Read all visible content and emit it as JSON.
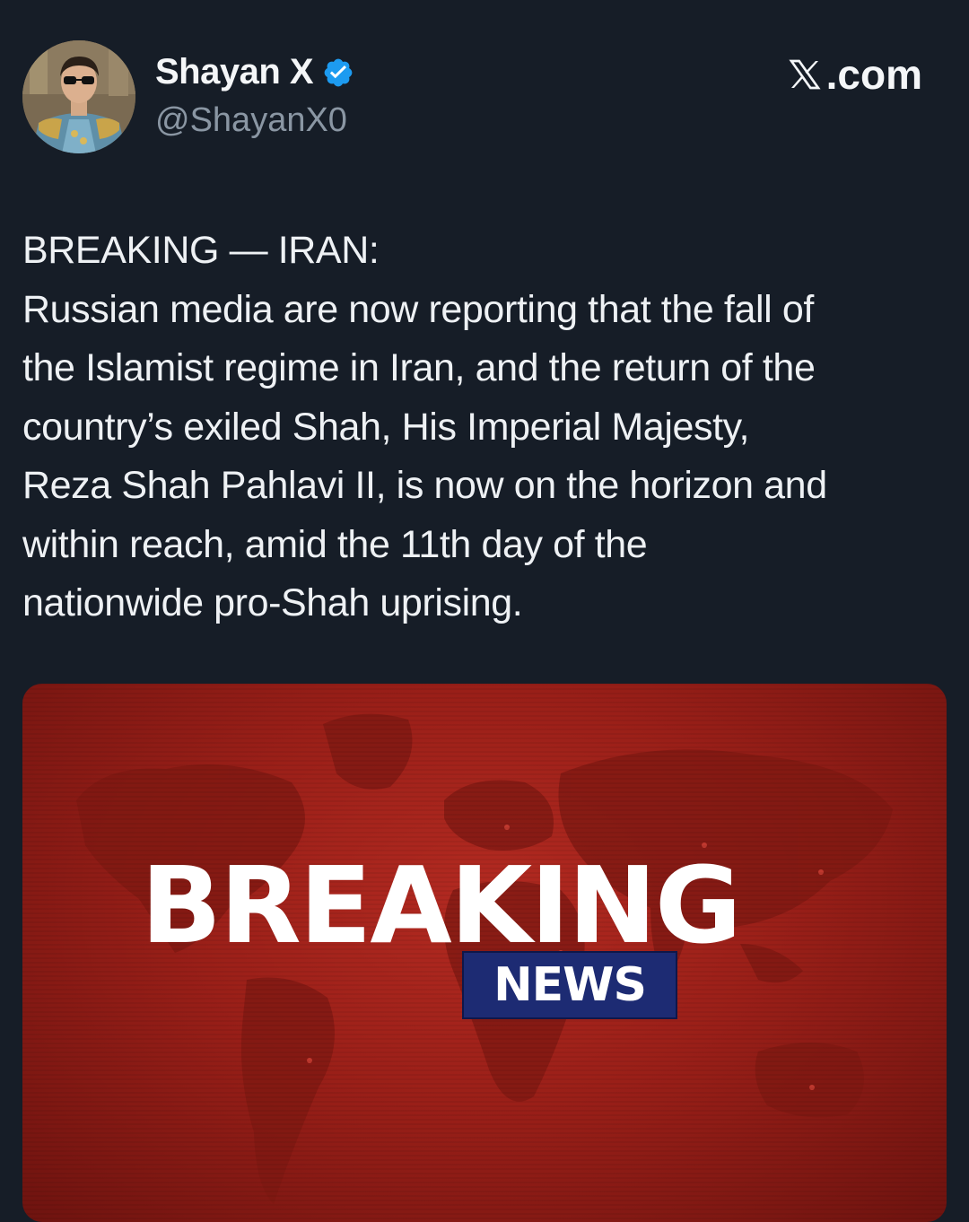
{
  "author": {
    "display_name": "Shayan X",
    "handle": "@ShayanX0",
    "verified_icon": "verified-badge-icon",
    "avatar_icon": "avatar-portrait-icon"
  },
  "site": {
    "label": ".com",
    "logo_icon": "x-logo-icon"
  },
  "tweet": {
    "lines": [
      "BREAKING — IRAN:",
      "Russian media are now reporting that the fall of",
      "the Islamist regime in Iran, and the return of the",
      "country’s exiled Shah, His Imperial Majesty,",
      "Reza Shah Pahlavi II, is now on the horizon and",
      "within reach, amid the 11th day of the",
      "nationwide pro-Shah uprising."
    ]
  },
  "media": {
    "headline": "BREAKING",
    "subheadline": "NEWS"
  },
  "colors": {
    "background": "#161d27",
    "verified": "#1d9bf0",
    "banner_red": "#a8241c",
    "news_box": "#1d2b73"
  }
}
